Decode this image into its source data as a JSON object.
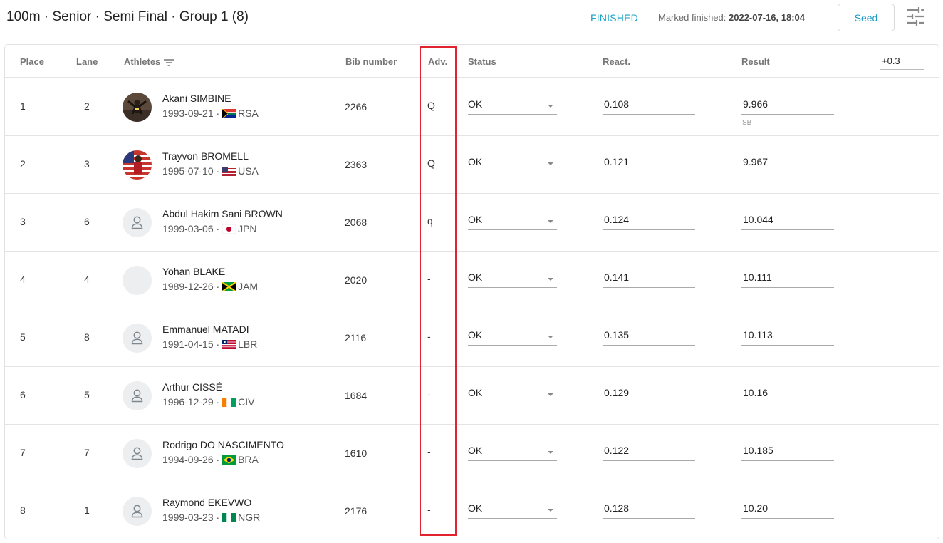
{
  "header": {
    "title": "100m · Senior · Semi Final · Group 1 (8)",
    "status": "FINISHED",
    "marked_label": "Marked finished:",
    "marked_value": "2022-07-16, 18:04",
    "seed_label": "Seed",
    "settings_icon": "tune-icon"
  },
  "columns": {
    "place": "Place",
    "lane": "Lane",
    "athletes": "Athletes",
    "bib": "Bib number",
    "adv": "Adv.",
    "status": "Status",
    "react": "React.",
    "result": "Result",
    "wind": "+0.3"
  },
  "rows": [
    {
      "place": "1",
      "lane": "2",
      "name": "Akani SIMBINE",
      "dob": "1993-09-21",
      "country": "RSA",
      "bib": "2266",
      "adv": "Q",
      "status": "OK",
      "react": "0.108",
      "result": "9.966",
      "note": "SB",
      "avatar": "photo"
    },
    {
      "place": "2",
      "lane": "3",
      "name": "Trayvon BROMELL",
      "dob": "1995-07-10",
      "country": "USA",
      "bib": "2363",
      "adv": "Q",
      "status": "OK",
      "react": "0.121",
      "result": "9.967",
      "note": "",
      "avatar": "photo"
    },
    {
      "place": "3",
      "lane": "6",
      "name": "Abdul Hakim Sani BROWN",
      "dob": "1999-03-06",
      "country": "JPN",
      "bib": "2068",
      "adv": "q",
      "status": "OK",
      "react": "0.124",
      "result": "10.044",
      "note": "",
      "avatar": "person"
    },
    {
      "place": "4",
      "lane": "4",
      "name": "Yohan BLAKE",
      "dob": "1989-12-26",
      "country": "JAM",
      "bib": "2020",
      "adv": "-",
      "status": "OK",
      "react": "0.141",
      "result": "10.111",
      "note": "",
      "avatar": "blank"
    },
    {
      "place": "5",
      "lane": "8",
      "name": "Emmanuel MATADI",
      "dob": "1991-04-15",
      "country": "LBR",
      "bib": "2116",
      "adv": "-",
      "status": "OK",
      "react": "0.135",
      "result": "10.113",
      "note": "",
      "avatar": "person"
    },
    {
      "place": "6",
      "lane": "5",
      "name": "Arthur CISSÉ",
      "dob": "1996-12-29",
      "country": "CIV",
      "bib": "1684",
      "adv": "-",
      "status": "OK",
      "react": "0.129",
      "result": "10.16",
      "note": "",
      "avatar": "person"
    },
    {
      "place": "7",
      "lane": "7",
      "name": "Rodrigo DO NASCIMENTO",
      "dob": "1994-09-26",
      "country": "BRA",
      "bib": "1610",
      "adv": "-",
      "status": "OK",
      "react": "0.122",
      "result": "10.185",
      "note": "",
      "avatar": "person"
    },
    {
      "place": "8",
      "lane": "1",
      "name": "Raymond EKEVWO",
      "dob": "1999-03-23",
      "country": "NGR",
      "bib": "2176",
      "adv": "-",
      "status": "OK",
      "react": "0.128",
      "result": "10.20",
      "note": "",
      "avatar": "person"
    }
  ],
  "colors": {
    "accent": "#19a3c7",
    "highlight": "#e0232e"
  }
}
